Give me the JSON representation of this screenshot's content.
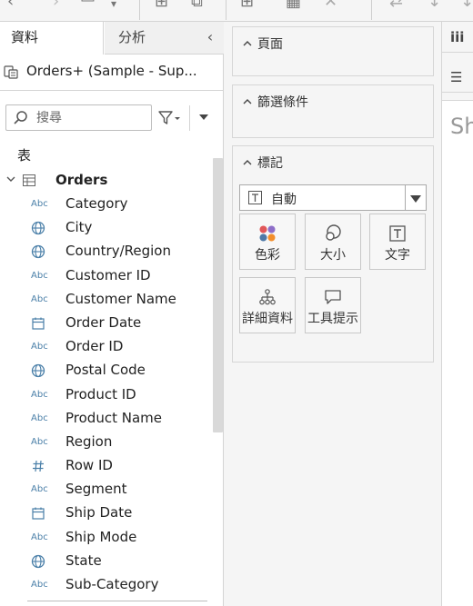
{
  "toolbar": {
    "icons": [
      "back-arrow-icon",
      "forward-arrow-icon",
      "save-icon",
      "new-worksheet-icon",
      "duplicate-icon",
      "new-data-source-icon",
      "clear-sheet-icon",
      "swap-rows-columns-icon",
      "sort-ascending-icon",
      "sort-descending-icon"
    ]
  },
  "data_pane": {
    "tabs": [
      {
        "label": "資料",
        "active": true
      },
      {
        "label": "分析",
        "active": false
      }
    ],
    "collapse_icon": "chevron-left-icon",
    "datasource": {
      "name": "Orders+ (Sample - Sup..."
    },
    "search": {
      "placeholder": "搜尋"
    },
    "tables_heading": "表",
    "table": {
      "name": "Orders"
    },
    "fields": [
      {
        "name": "Category",
        "type": "string"
      },
      {
        "name": "City",
        "type": "geo"
      },
      {
        "name": "Country/Region",
        "type": "geo"
      },
      {
        "name": "Customer ID",
        "type": "string"
      },
      {
        "name": "Customer Name",
        "type": "string"
      },
      {
        "name": "Order Date",
        "type": "date"
      },
      {
        "name": "Order ID",
        "type": "string"
      },
      {
        "name": "Postal Code",
        "type": "geo"
      },
      {
        "name": "Product ID",
        "type": "string"
      },
      {
        "name": "Product Name",
        "type": "string"
      },
      {
        "name": "Region",
        "type": "string"
      },
      {
        "name": "Row ID",
        "type": "number"
      },
      {
        "name": "Segment",
        "type": "string"
      },
      {
        "name": "Ship Date",
        "type": "date"
      },
      {
        "name": "Ship Mode",
        "type": "string"
      },
      {
        "name": "State",
        "type": "geo"
      },
      {
        "name": "Sub-Category",
        "type": "string"
      }
    ],
    "string_badge": "Abc"
  },
  "cards": {
    "pages": {
      "label": "頁面"
    },
    "filters": {
      "label": "篩選條件"
    },
    "marks": {
      "label": "標記",
      "type_value": "自動",
      "buttons": [
        {
          "label": "色彩",
          "icon": "color-dots-icon"
        },
        {
          "label": "大小",
          "icon": "size-icon"
        },
        {
          "label": "文字",
          "icon": "text-icon"
        },
        {
          "label": "詳細資料",
          "icon": "detail-icon"
        },
        {
          "label": "工具提示",
          "icon": "tooltip-icon"
        }
      ]
    }
  },
  "right_edge": {
    "columns_icon_text": "iii",
    "rows_icon": "rows-icon",
    "sheet_title": "Sh"
  },
  "colors": {
    "accent_blue": "#4a7fa8",
    "dot_red": "#e15759",
    "dot_purple": "#8e6ec8",
    "dot_blue": "#4e79a7",
    "dot_orange": "#f28e2b"
  }
}
